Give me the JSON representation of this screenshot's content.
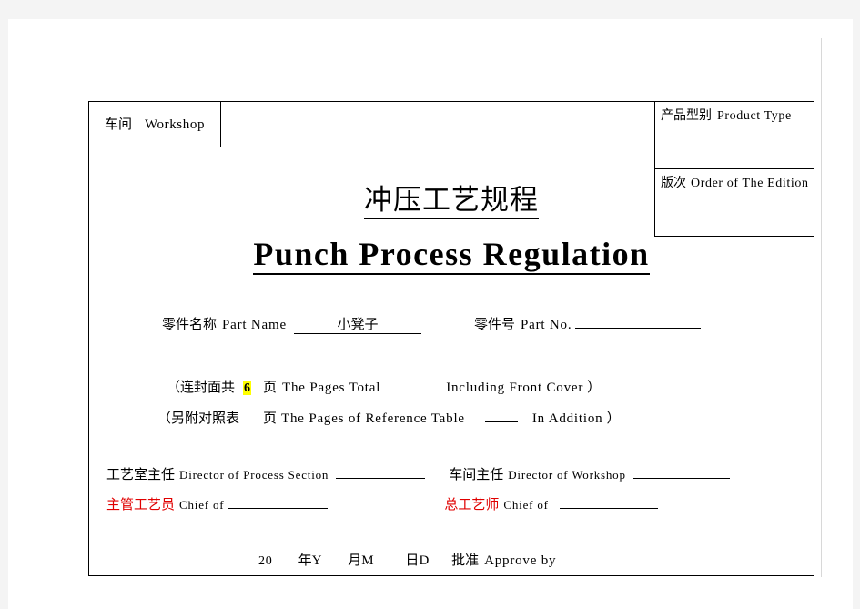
{
  "document": {
    "workshop_cell": {
      "label_cn": "车间",
      "label_en": "Workshop"
    },
    "product_type_cell": {
      "label_cn": "产品型别",
      "label_en": "Product Type"
    },
    "edition_cell": {
      "label_cn": "版次",
      "label_en": "Order of The Edition"
    },
    "title_cn": "冲压工艺规程",
    "title_en": "Punch  Process  Regulation",
    "part_name_row": {
      "label_cn": "零件名称",
      "label_en": "Part Name",
      "value": "小凳子",
      "part_no_label_cn": "零件号",
      "part_no_label_en": "Part No.",
      "part_no_value": ""
    },
    "pages_total_row": {
      "open_paren": "（",
      "label_cn": "连封面共",
      "count": "6",
      "unit_cn": "页",
      "label_en": "The Pages Total",
      "blank_value": "",
      "label_en2": "Including  Front  Cover",
      "close_paren": "）"
    },
    "reference_table_row": {
      "open_paren": "（",
      "label_cn": "另附对照表",
      "unit_cn": "页",
      "label_en": "The Pages of Reference Table",
      "blank_value": "",
      "label_en2": "In  Addition",
      "close_paren": "）"
    },
    "signature_row_1": {
      "left_label_cn": "工艺室主任",
      "left_label_en": "Director  of  Process  Section",
      "left_value": "",
      "right_label_cn": "车间主任",
      "right_label_en": "Director  of  Workshop",
      "right_value": ""
    },
    "signature_row_2": {
      "left_label_cn": "主管工艺员",
      "left_label_en": "Chief of",
      "left_value": "",
      "right_label_cn": "总工艺师",
      "right_label_en": "Chief of",
      "right_value": ""
    },
    "date_row": {
      "year_prefix": "20",
      "year_cn": "年",
      "year_en": "Y",
      "month_cn": "月",
      "month_en": "M",
      "day_cn": "日",
      "day_en": "D",
      "approve_cn": "批准",
      "approve_en": "Approve  by"
    },
    "colors": {
      "red_text": "#e00000",
      "highlight": "#ffff00",
      "border": "#000000",
      "page_background": "#ffffff",
      "surround": "#f4f4f4"
    }
  }
}
